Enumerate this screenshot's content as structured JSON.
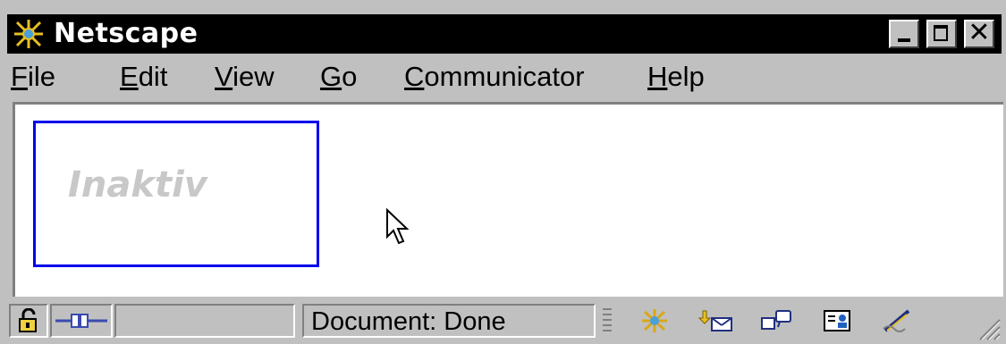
{
  "window": {
    "title": "Netscape",
    "colors": {
      "titlebar": "#000000",
      "face": "#c0c0c0",
      "link_border": "#0000ee",
      "inactive_text": "#c8c8c8"
    }
  },
  "window_controls": {
    "minimize_icon": "minimize-icon",
    "maximize_icon": "maximize-icon",
    "close_glyph": "✕"
  },
  "menu": {
    "items": [
      {
        "mnemonic": "F",
        "rest": "ile"
      },
      {
        "mnemonic": "E",
        "rest": "dit"
      },
      {
        "mnemonic": "V",
        "rest": "iew"
      },
      {
        "mnemonic": "G",
        "rest": "o"
      },
      {
        "mnemonic": "C",
        "rest": "ommunicator"
      },
      {
        "mnemonic": "H",
        "rest": "elp"
      }
    ]
  },
  "content": {
    "inactive_label": "Inaktiv"
  },
  "status": {
    "text": "Document: Done",
    "icons": [
      "security-lock-icon",
      "connection-plug-icon",
      "navigator-icon",
      "mailbox-icon",
      "discussions-icon",
      "composer-icon",
      "address-book-icon"
    ]
  }
}
